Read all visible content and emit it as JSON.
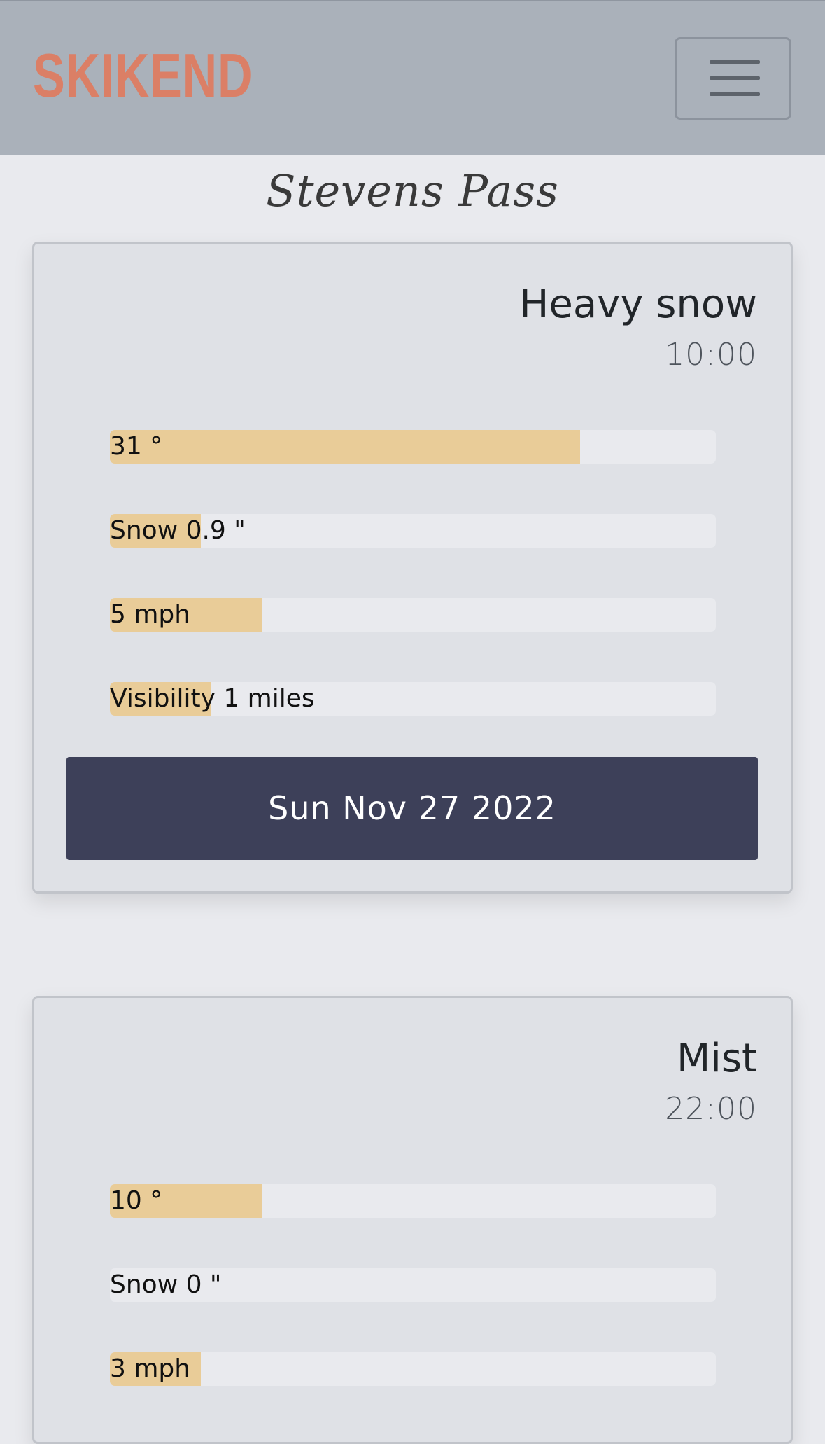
{
  "navbar": {
    "brand": "SKIKEND",
    "brand_color": "#db7f66",
    "menu_icon": "hamburger-menu-icon"
  },
  "page": {
    "title": "Stevens Pass"
  },
  "forecasts": [
    {
      "condition": "Heavy snow",
      "time": "10:00",
      "temperature": {
        "label": "31 °",
        "level_fraction": 0.776
      },
      "snow": {
        "label": "Snow 0.9 \"",
        "level_fraction": 0.15
      },
      "wind": {
        "label": "5 mph",
        "level_fraction": 0.25
      },
      "visibility": {
        "label": "Visibility 1 miles",
        "level_fraction": 0.167
      },
      "date": "Sun Nov 27 2022"
    },
    {
      "condition": "Mist",
      "time": "22:00",
      "temperature": {
        "label": "10 °",
        "level_fraction": 0.25
      },
      "snow": {
        "label": "Snow 0 \"",
        "level_fraction": 0
      },
      "wind": {
        "label": "3 mph",
        "level_fraction": 0.15
      }
    }
  ],
  "colors": {
    "navbar_bg": "#aab1ba",
    "card_bg": "#dfe1e6",
    "meter_fill": "#e9cc98",
    "date_bar_bg": "#3d4059"
  }
}
